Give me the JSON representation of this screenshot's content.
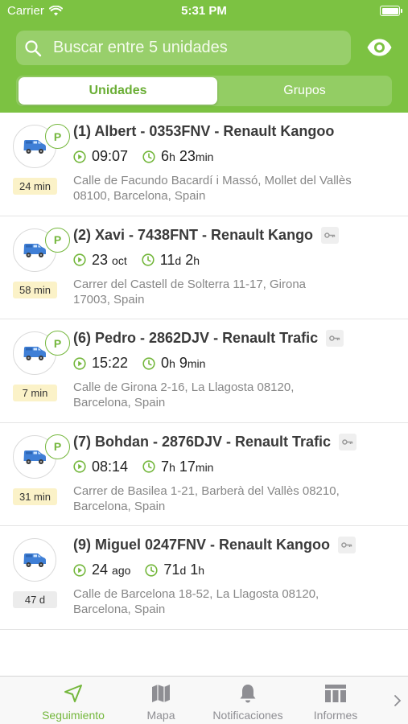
{
  "status_bar": {
    "carrier": "Carrier",
    "time": "5:31 PM",
    "battery_level": 1.0
  },
  "search": {
    "placeholder": "Buscar entre 5 unidades"
  },
  "segments": {
    "active": "Unidades",
    "inactive": "Grupos"
  },
  "units": [
    {
      "title": "(1) Albert - 0353FNV - Renault Kangoo",
      "parked": true,
      "key": false,
      "start": "09:07",
      "start_unit": "",
      "duration_a": "6",
      "duration_a_unit": "h",
      "duration_b": "23",
      "duration_b_unit": "min",
      "badge": "24 min",
      "badge_color": "yellow",
      "address_1": "Calle de Facundo Bacardí i Massó, Mollet del Vallès",
      "address_2": "08100, Barcelona, Spain"
    },
    {
      "title": "(2) Xavi - 7438FNT - Renault Kango",
      "parked": true,
      "key": true,
      "start": "23",
      "start_unit": "oct",
      "duration_a": "11",
      "duration_a_unit": "d",
      "duration_b": "2",
      "duration_b_unit": "h",
      "badge": "58 min",
      "badge_color": "yellow",
      "address_1": "Carrer del Castell de Solterra 11-17, Girona",
      "address_2": "17003, Spain"
    },
    {
      "title": "(6) Pedro - 2862DJV - Renault Trafic",
      "parked": true,
      "key": true,
      "start": "15:22",
      "start_unit": "",
      "duration_a": "0",
      "duration_a_unit": "h",
      "duration_b": "9",
      "duration_b_unit": "min",
      "badge": "7 min",
      "badge_color": "yellow",
      "address_1": "Calle de Girona 2-16, La Llagosta 08120,",
      "address_2": "Barcelona, Spain"
    },
    {
      "title": "(7) Bohdan - 2876DJV - Renault Trafic",
      "parked": true,
      "key": true,
      "start": "08:14",
      "start_unit": "",
      "duration_a": "7",
      "duration_a_unit": "h",
      "duration_b": "17",
      "duration_b_unit": "min",
      "badge": "31 min",
      "badge_color": "yellow",
      "address_1": "Carrer de Basilea 1-21, Barberà del Vallès 08210,",
      "address_2": "Barcelona, Spain"
    },
    {
      "title": "(9) Miguel 0247FNV - Renault Kangoo",
      "parked": false,
      "key": true,
      "start": "24",
      "start_unit": "ago",
      "duration_a": "71",
      "duration_a_unit": "d",
      "duration_b": "1",
      "duration_b_unit": "h",
      "badge": "47 d",
      "badge_color": "grey",
      "address_1": "Calle de Barcelona 18-52, La Llagosta 08120,",
      "address_2": "Barcelona, Spain"
    }
  ],
  "tabbar": {
    "items": [
      {
        "label": "Seguimiento",
        "icon": "navigation-arrow-icon",
        "active": true
      },
      {
        "label": "Mapa",
        "icon": "map-icon",
        "active": false
      },
      {
        "label": "Notificaciones",
        "icon": "bell-icon",
        "active": false
      },
      {
        "label": "Informes",
        "icon": "reports-icon",
        "active": false
      }
    ],
    "more_icon": "chevron-right-icon"
  },
  "colors": {
    "accent": "#7cc242",
    "parking": "#74b73c",
    "van": "#3f7fd6",
    "badge_yellow": "#fbf2c8",
    "badge_grey": "#ececec"
  }
}
